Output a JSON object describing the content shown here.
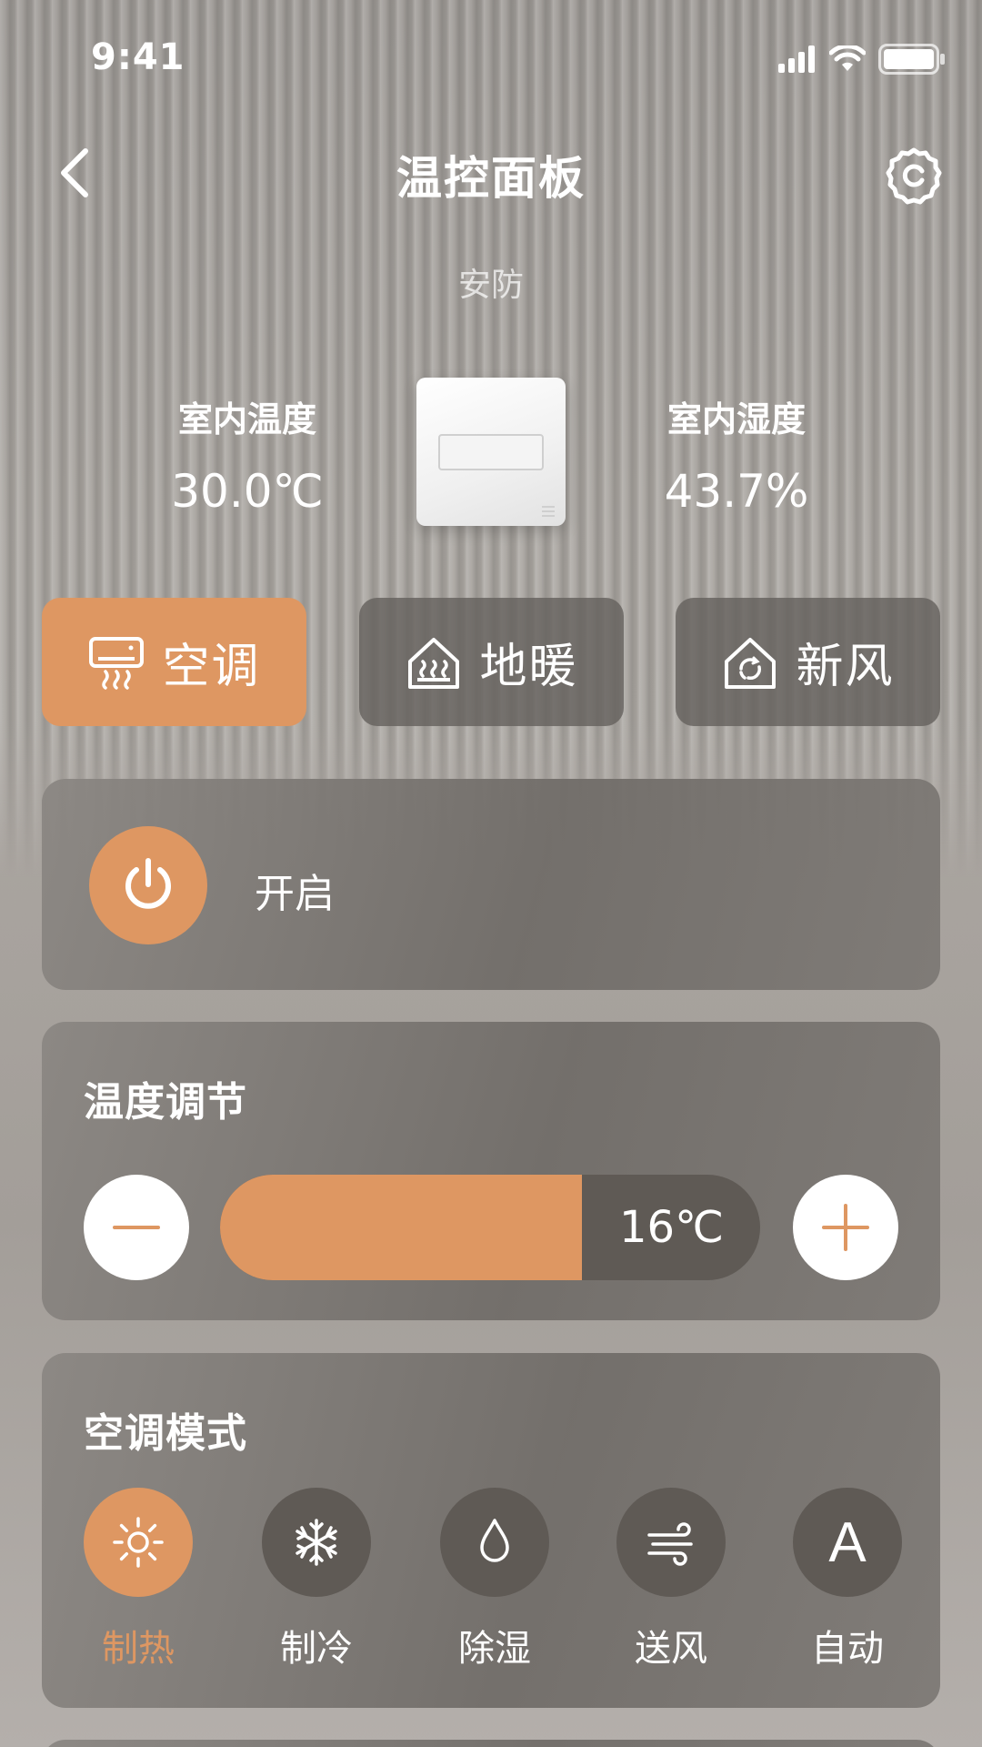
{
  "status_bar": {
    "time": "9:41"
  },
  "nav": {
    "title": "温控面板",
    "back_icon": "chevron-left-icon",
    "settings_icon": "gear-icon"
  },
  "device": {
    "subtitle": "安防"
  },
  "sensors": {
    "temperature": {
      "label": "室内温度",
      "value": "30.0℃"
    },
    "humidity": {
      "label": "室内湿度",
      "value": "43.7%"
    }
  },
  "tabs": [
    {
      "label": "空调",
      "icon": "air-conditioner-icon",
      "active": true
    },
    {
      "label": "地暖",
      "icon": "floor-heating-icon",
      "active": false
    },
    {
      "label": "新风",
      "icon": "fresh-air-icon",
      "active": false
    }
  ],
  "power": {
    "label": "开启",
    "on": true
  },
  "temperature_control": {
    "title": "温度调节",
    "value": "16℃",
    "fill_fraction": 0.67
  },
  "mode": {
    "title": "空调模式",
    "items": [
      {
        "label": "制热",
        "icon": "sun-icon",
        "active": true
      },
      {
        "label": "制冷",
        "icon": "snowflake-icon",
        "active": false
      },
      {
        "label": "除湿",
        "icon": "droplet-icon",
        "active": false
      },
      {
        "label": "送风",
        "icon": "wind-icon",
        "active": false
      },
      {
        "label": "自动",
        "icon": "auto-icon",
        "glyph": "A",
        "active": false
      }
    ]
  },
  "colors": {
    "accent": "#de9762",
    "card": "#6f6b67",
    "dark_fill": "#5f5a55"
  }
}
